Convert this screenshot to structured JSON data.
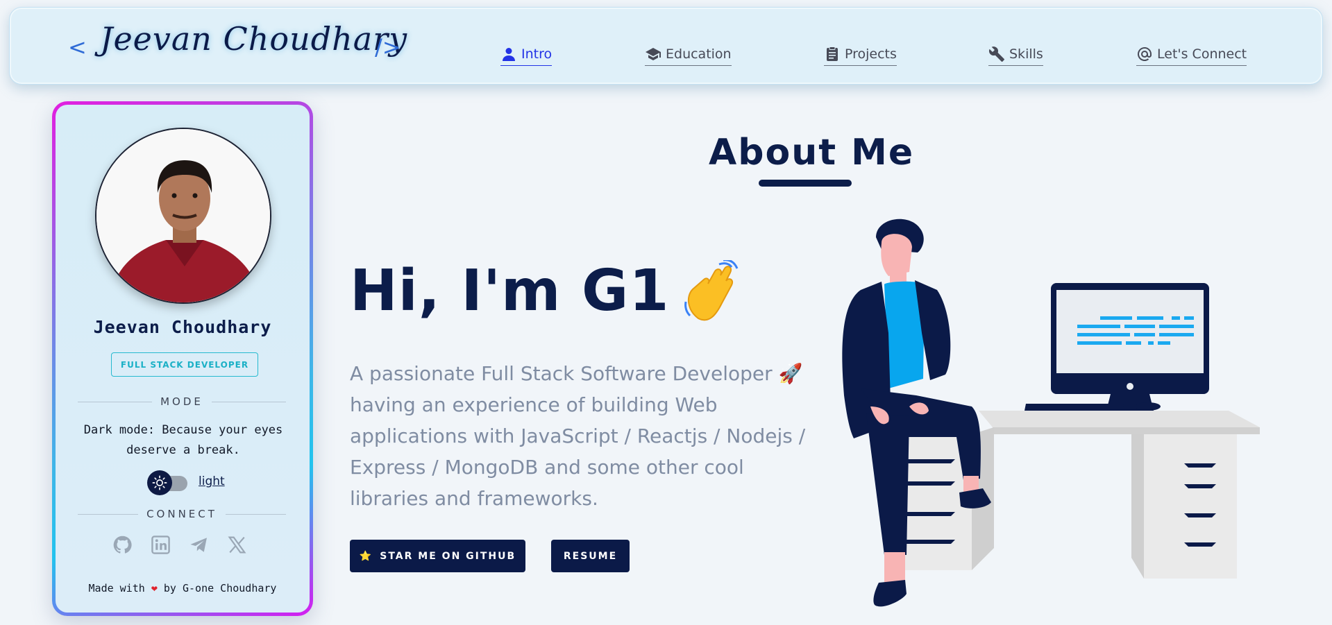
{
  "navbar": {
    "logo_open": "<",
    "logo_name": "Jeevan Choudhary",
    "logo_close": "/>",
    "items": [
      {
        "label": "Intro",
        "icon": "person-icon",
        "active": true
      },
      {
        "label": "Education",
        "icon": "graduation-cap-icon",
        "active": false
      },
      {
        "label": "Projects",
        "icon": "clipboard-icon",
        "active": false
      },
      {
        "label": "Skills",
        "icon": "wrench-icon",
        "active": false
      },
      {
        "label": "Let's Connect",
        "icon": "at-sign-icon",
        "active": false
      }
    ]
  },
  "profile": {
    "name": "Jeevan Choudhary",
    "role": "FULL STACK DEVELOPER",
    "mode_heading": "MODE",
    "mode_text": "Dark mode: Because your eyes deserve a break.",
    "theme_label": "light",
    "connect_heading": "CONNECT",
    "socials": [
      "github-icon",
      "linkedin-icon",
      "telegram-icon",
      "x-icon"
    ],
    "footer_prefix": "Made with",
    "footer_heart": "❤",
    "footer_suffix": "by G-one Choudhary"
  },
  "main": {
    "section_title": "About Me",
    "greeting": "Hi, I'm G1",
    "intro": "A passionate Full Stack Software Developer 🚀 having an experience of building Web applications with JavaScript / Reactjs / Nodejs / Express / MongoDB and some other cool libraries and frameworks.",
    "github_button": "STAR ME ON GITHUB",
    "github_button_icon": "⭐",
    "resume_button": "RESUME"
  },
  "colors": {
    "navy": "#0b1a48",
    "accent_blue": "#2233e6",
    "teal": "#1ab0c6",
    "screen_code": "#1aa9f0"
  }
}
